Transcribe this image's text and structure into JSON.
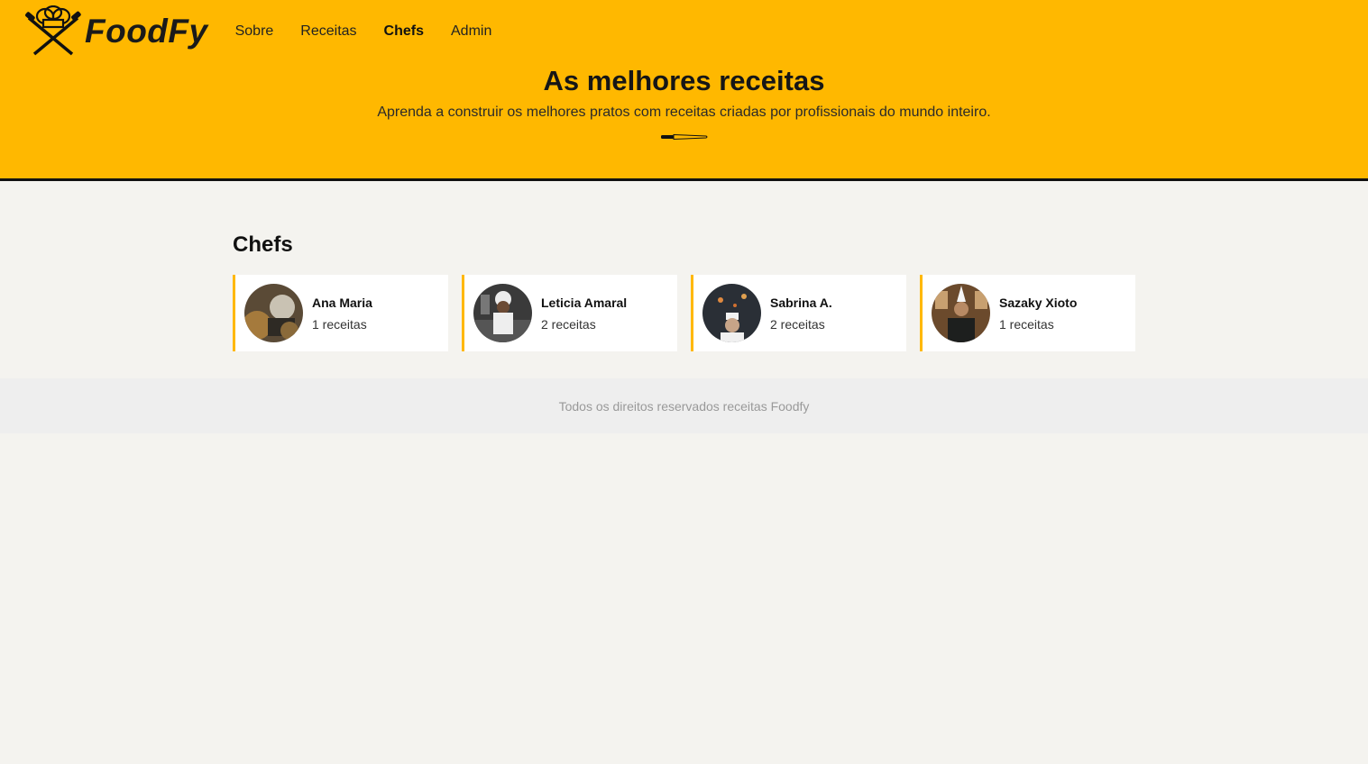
{
  "brand": {
    "name": "FoodFy",
    "icon": "chef-logo-icon"
  },
  "nav": {
    "items": [
      {
        "label": "Sobre",
        "active": false
      },
      {
        "label": "Receitas",
        "active": false
      },
      {
        "label": "Chefs",
        "active": true
      },
      {
        "label": "Admin",
        "active": false
      }
    ]
  },
  "hero": {
    "title": "As melhores receitas",
    "subtitle": "Aprenda a construir os melhores pratos com receitas criadas por profissionais do mundo inteiro.",
    "icon": "knife-icon"
  },
  "section": {
    "title": "Chefs"
  },
  "chefs": [
    {
      "name": "Ana Maria",
      "recipes": "1 receitas"
    },
    {
      "name": "Leticia Amaral",
      "recipes": "2 receitas"
    },
    {
      "name": "Sabrina A.",
      "recipes": "2 receitas"
    },
    {
      "name": "Sazaky Xioto",
      "recipes": "1 receitas"
    }
  ],
  "footer": {
    "text": "Todos os direitos reservados receitas Foodfy"
  },
  "colors": {
    "accent": "#ffb800",
    "background": "#f4f3ef",
    "footer": "#eeeeee"
  }
}
